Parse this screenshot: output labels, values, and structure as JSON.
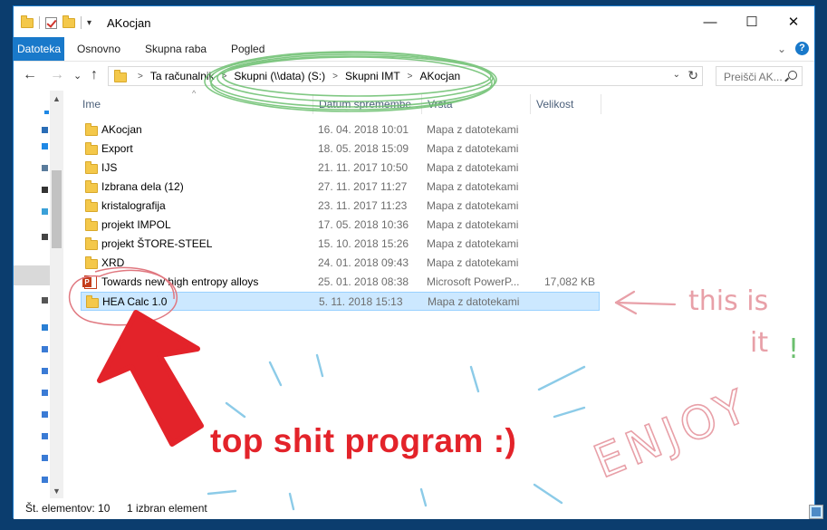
{
  "window": {
    "title": "AKocjan"
  },
  "window_controls": {
    "minimize": "—",
    "maximize": "☐",
    "close": "✕"
  },
  "ribbon": {
    "tabs": [
      "Datoteka",
      "Osnovno",
      "Skupna raba",
      "Pogled"
    ],
    "help": "?"
  },
  "nav": {
    "back": "←",
    "forward": "→",
    "recent": "⌄",
    "up": "↑"
  },
  "address": {
    "crumbs": [
      "Ta računalnik",
      "Skupni (\\\\data) (S:)",
      "Skupni IMT",
      "AKocjan"
    ],
    "separator": ">"
  },
  "search": {
    "placeholder": "Preišči AK..."
  },
  "columns": {
    "name": "Ime",
    "date": "Datum spremembe",
    "type": "Vrsta",
    "size": "Velikost"
  },
  "files": [
    {
      "name": "AKocjan",
      "date": "16. 04. 2018 10:01",
      "type": "Mapa z datotekami",
      "size": "",
      "icon": "folder-icon"
    },
    {
      "name": "Export",
      "date": "18. 05. 2018 15:09",
      "type": "Mapa z datotekami",
      "size": "",
      "icon": "folder-icon"
    },
    {
      "name": "IJS",
      "date": "21. 11. 2017 10:50",
      "type": "Mapa z datotekami",
      "size": "",
      "icon": "folder-icon"
    },
    {
      "name": "Izbrana dela (12)",
      "date": "27. 11. 2017 11:27",
      "type": "Mapa z datotekami",
      "size": "",
      "icon": "folder-icon"
    },
    {
      "name": "kristalografija",
      "date": "23. 11. 2017 11:23",
      "type": "Mapa z datotekami",
      "size": "",
      "icon": "folder-icon"
    },
    {
      "name": "projekt IMPOL",
      "date": "17. 05. 2018 10:36",
      "type": "Mapa z datotekami",
      "size": "",
      "icon": "folder-icon"
    },
    {
      "name": "projekt ŠTORE-STEEL",
      "date": "15. 10. 2018 15:26",
      "type": "Mapa z datotekami",
      "size": "",
      "icon": "folder-icon"
    },
    {
      "name": "XRD",
      "date": "24. 01. 2018 09:43",
      "type": "Mapa z datotekami",
      "size": "",
      "icon": "folder-icon"
    },
    {
      "name": "Towards new high entropy alloys",
      "date": "25. 01. 2018 08:38",
      "type": "Microsoft PowerP...",
      "size": "17,082 KB",
      "icon": "powerpoint-icon"
    },
    {
      "name": "HEA Calc 1.0",
      "date": "5. 11. 2018 15:13",
      "type": "Mapa z datotekami",
      "size": "",
      "icon": "folder-icon",
      "selected": true
    }
  ],
  "status": {
    "count": "Št. elementov: 10",
    "selection": "1 izbran element"
  },
  "annotations": {
    "main_text": "top shit program :)",
    "arrow_note": "this is it!",
    "enjoy": "ENJOY",
    "colors": {
      "red": "#e3232a",
      "pink": "#e8a0a8",
      "green": "#6bbf6e",
      "blue": "#8ccbe8"
    }
  }
}
